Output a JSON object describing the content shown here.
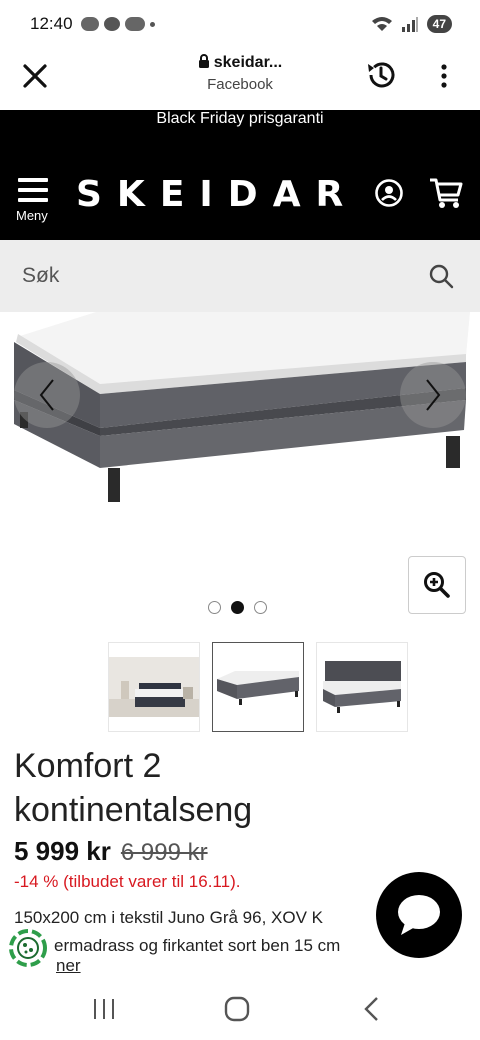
{
  "status_bar": {
    "time": "12:40",
    "battery": "47"
  },
  "browser": {
    "domain": "skeidar...",
    "source": "Facebook"
  },
  "promo_banner": "Black Friday prisgaranti",
  "site_header": {
    "logo": "SKEIDAR",
    "menu_label": "Meny"
  },
  "search": {
    "placeholder": "Søk"
  },
  "gallery": {
    "dots": 3,
    "active_dot": 2
  },
  "product": {
    "title": "Komfort 2 kontinentalseng",
    "price": "5 999 kr",
    "old_price": "6 999 kr",
    "discount": "-14 % (tilbudet varer til 16.11).",
    "description_line1": "150x200 cm i tekstil Juno Grå 96, XOV K",
    "description_line2": "ermadrass og firkantet sort ben 15 cm",
    "more_link": "ner"
  },
  "colors": {
    "header_bg": "#000000",
    "discount": "#d81920",
    "search_bg": "#ededed"
  },
  "icons": [
    "close-icon",
    "lock-icon",
    "history-icon",
    "more-vert-icon",
    "menu-icon",
    "account-icon",
    "cart-icon",
    "search-icon",
    "chevron-left-icon",
    "chevron-right-icon",
    "zoom-in-icon",
    "chat-icon",
    "cookie-icon"
  ]
}
